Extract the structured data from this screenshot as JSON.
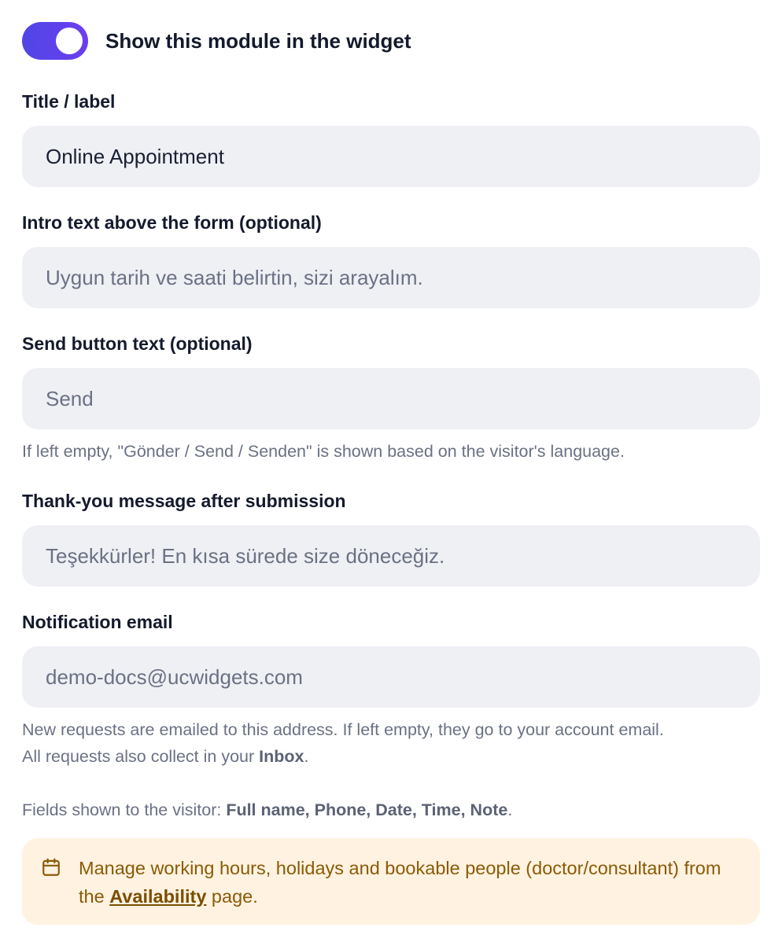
{
  "toggle": {
    "label": "Show this module in the widget",
    "on": true,
    "color": "#5b3fe8"
  },
  "fields": {
    "title": {
      "label": "Title / label",
      "value": "Online Appointment"
    },
    "intro": {
      "label": "Intro text above the form (optional)",
      "placeholder": "Uygun tarih ve saati belirtin, sizi arayalım."
    },
    "send": {
      "label": "Send button text (optional)",
      "placeholder": "Send",
      "hint": "If left empty, \"Gönder / Send / Senden\" is shown based on the visitor's language."
    },
    "thanks": {
      "label": "Thank-you message after submission",
      "placeholder": "Teşekkürler! En kısa sürede size döneceğiz."
    },
    "email": {
      "label": "Notification email",
      "placeholder": "demo-docs@ucwidgets.com",
      "hint_line1": "New requests are emailed to this address. If left empty, they go to your account email.",
      "hint_line2_prefix": "All requests also collect in your ",
      "hint_line2_bold": "Inbox",
      "hint_line2_suffix": "."
    }
  },
  "fields_shown": {
    "prefix": "Fields shown to the visitor: ",
    "list": "Full name, Phone, Date, Time, Note",
    "suffix": "."
  },
  "notice": {
    "icon": "calendar-icon",
    "text_before": "Manage working hours, holidays and bookable people (doctor/consultant) from the ",
    "link_text": "Availability",
    "text_after": " page.",
    "background": "#fff2e0",
    "text_color": "#8a5a06"
  }
}
